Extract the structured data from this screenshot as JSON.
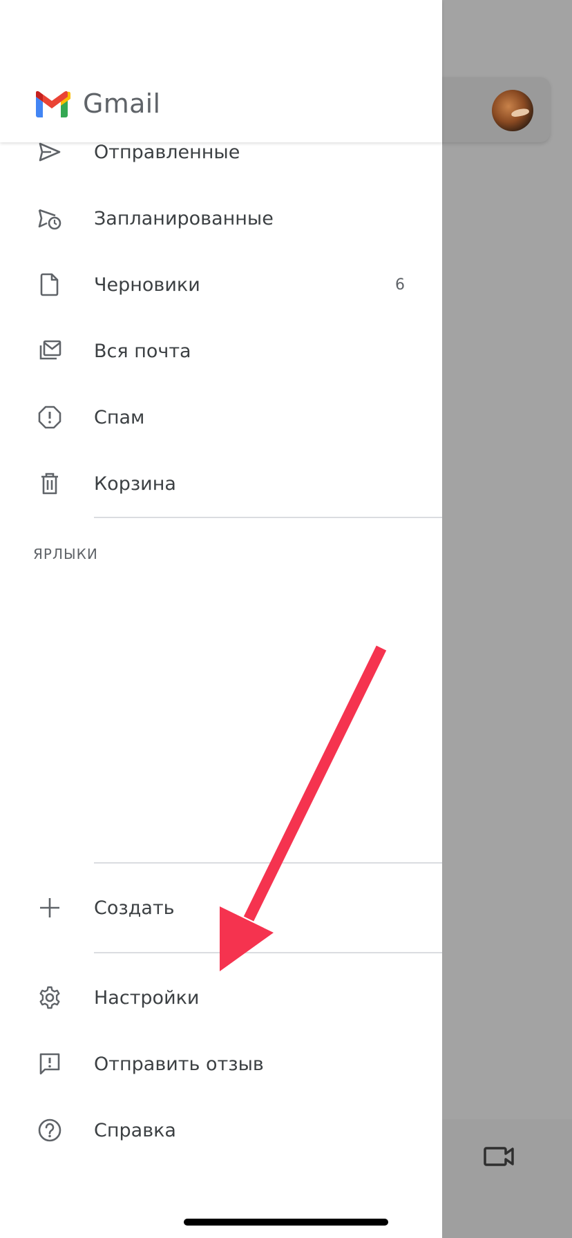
{
  "app": {
    "brand_name": "Gmail"
  },
  "nav_items": [
    {
      "label": "Отправленные",
      "icon": "send-icon"
    },
    {
      "label": "Запланированные",
      "icon": "scheduled-icon"
    },
    {
      "label": "Черновики",
      "icon": "draft-icon",
      "count": "6"
    },
    {
      "label": "Вся почта",
      "icon": "all-mail-icon"
    },
    {
      "label": "Спам",
      "icon": "spam-icon"
    },
    {
      "label": "Корзина",
      "icon": "trash-icon"
    }
  ],
  "labels_section": {
    "title": "ЯРЛЫКИ"
  },
  "actions": [
    {
      "label": "Создать",
      "icon": "plus-icon"
    },
    {
      "label": "Настройки",
      "icon": "gear-icon"
    },
    {
      "label": "Отправить отзыв",
      "icon": "feedback-icon"
    },
    {
      "label": "Справка",
      "icon": "help-icon"
    }
  ],
  "colors": {
    "annotation_arrow": "#f5334f",
    "scrim": "#a3a3a3",
    "text_primary": "#3c4043",
    "text_secondary": "#5f6368",
    "gmail_red": "#ea4335",
    "gmail_blue": "#4285f4",
    "gmail_green": "#34a853",
    "gmail_yellow": "#fbbc04"
  }
}
